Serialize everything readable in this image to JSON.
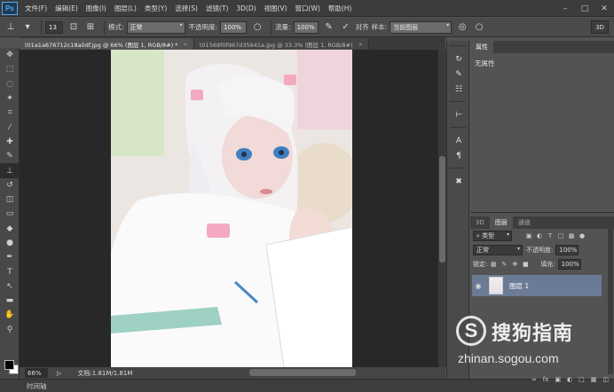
{
  "app": {
    "logo": "Ps"
  },
  "menu": [
    "文件(F)",
    "编辑(E)",
    "图像(I)",
    "图层(L)",
    "类型(Y)",
    "选择(S)",
    "滤镜(T)",
    "3D(D)",
    "视图(V)",
    "窗口(W)",
    "帮助(H)"
  ],
  "options": {
    "brush_size": "13",
    "mode_label": "模式:",
    "mode_value": "正常",
    "opacity_label": "不透明度:",
    "opacity_value": "100%",
    "flow_label": "流量:",
    "flow_value": "100%",
    "aligned_label": "对齐",
    "sample_label": "样本:",
    "sample_value": "当前图层",
    "btn_3d": "3D"
  },
  "tabs": [
    {
      "label": "t01a1a676712c18a0df.jpg @ 66% (图层 1, RGB/8#) *",
      "close": "×"
    },
    {
      "label": "t01569f0f967d35641a.jpg @ 33.3% (图层 1, RGB/8#)",
      "close": "×"
    }
  ],
  "status": {
    "zoom": "66%",
    "doc": "文档:1.81M/1.81M"
  },
  "timeline": {
    "label": "时间轴"
  },
  "properties": {
    "tab": "属性",
    "body": "无属性"
  },
  "layers": {
    "tabs": [
      "3D",
      "图层",
      "通道"
    ],
    "filter_kind": "类型",
    "blend_mode": "正常",
    "opacity_label": "不透明度:",
    "opacity_value": "100%",
    "lock_label": "锁定:",
    "fill_label": "填充:",
    "fill_value": "100%",
    "layer_name": "图层 1"
  },
  "watermark": {
    "logo": "S",
    "title": "搜狗指南",
    "url": "zhinan.sogou.com"
  },
  "icons": {
    "stamp": "⊥",
    "brush_preset": "●",
    "toggle": "⊡",
    "clone": "⊞",
    "move": "✥",
    "marquee": "⬚",
    "lasso": "◌",
    "wand": "✦",
    "crop": "⌗",
    "eyedropper": "⁄",
    "heal": "✚",
    "brush": "✎",
    "clone_stamp": "⊥",
    "history": "↺",
    "eraser": "◫",
    "gradient": "▭",
    "blur": "◆",
    "dodge": "●",
    "pen": "✒",
    "type": "T",
    "path": "↖",
    "shape": "▬",
    "hand": "✋",
    "zoom": "⚲",
    "mask": "◘"
  }
}
